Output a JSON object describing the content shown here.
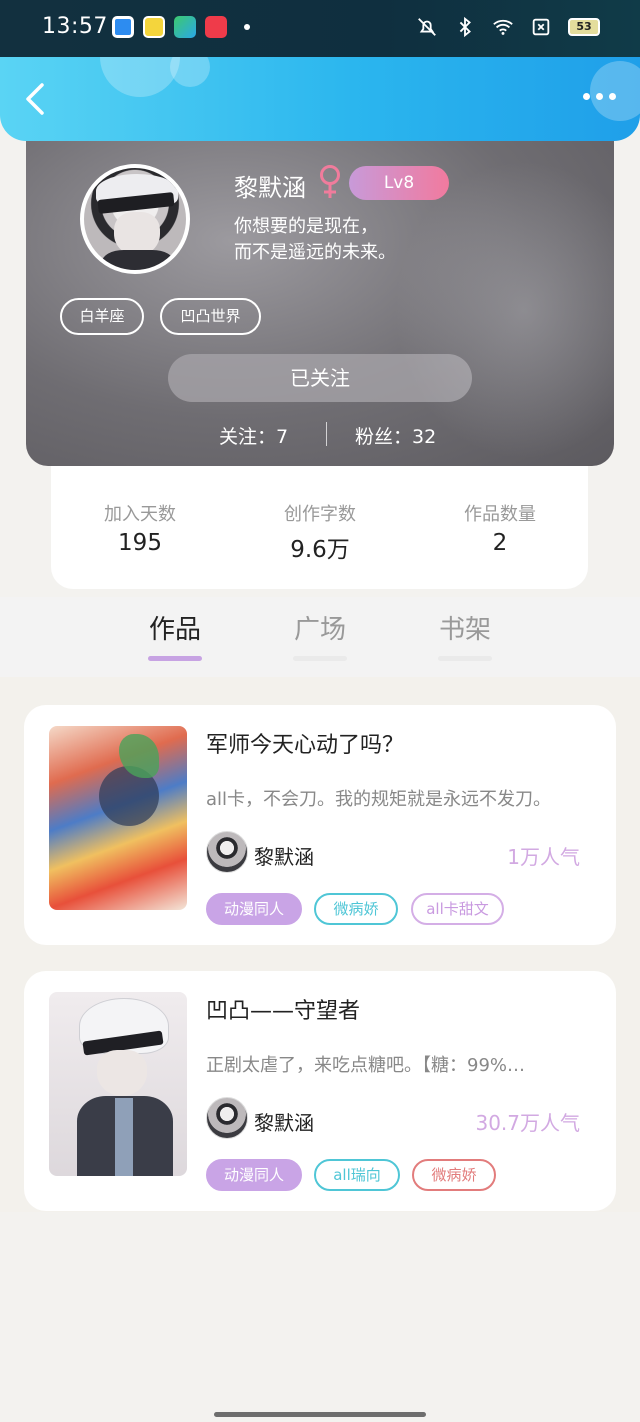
{
  "status_bar": {
    "time": "13:57",
    "battery": "53",
    "icons": [
      "app-blue-icon",
      "app-yellow-icon",
      "app-green-icon",
      "app-red-icon",
      "mute-bell-icon",
      "bluetooth-icon",
      "wifi-icon",
      "sim-x-icon",
      "battery-icon"
    ]
  },
  "header": {
    "back_icon": "chevron-left-icon",
    "more_icon": "ellipsis-icon"
  },
  "profile": {
    "name": "黎默涵",
    "gender_icon": "female-icon",
    "level": "Lv8",
    "bio_line1": "你想要的是现在，",
    "bio_line2": "而不是遥远的未来。",
    "tags": [
      "白羊座",
      "凹凸世界"
    ],
    "follow_button": "已关注",
    "following": "关注：7",
    "fans": "粉丝：32"
  },
  "stats": [
    {
      "label": "加入天数",
      "value": "195"
    },
    {
      "label": "创作字数",
      "value": "9.6万"
    },
    {
      "label": "作品数量",
      "value": "2"
    }
  ],
  "tabs": [
    {
      "label": "作品",
      "active": true
    },
    {
      "label": "广场",
      "active": false
    },
    {
      "label": "书架",
      "active": false
    }
  ],
  "works": [
    {
      "title": "军师今天心动了吗？",
      "description": "all卡，不会刀。我的规矩就是永远不发刀。",
      "author": "黎默涵",
      "popularity": "1万人气",
      "tags": [
        {
          "label": "动漫同人",
          "style": "filled-purple"
        },
        {
          "label": "微病娇",
          "style": "outline-cyan"
        },
        {
          "label": "all卡甜文",
          "style": "outline-purple"
        }
      ]
    },
    {
      "title": "凹凸——守望者",
      "description": "正剧太虐了，来吃点糖吧。【糖：99%…",
      "author": "黎默涵",
      "popularity": "30.7万人气",
      "tags": [
        {
          "label": "动漫同人",
          "style": "filled-purple"
        },
        {
          "label": "all瑞向",
          "style": "outline-cyan"
        },
        {
          "label": "微病娇",
          "style": "outline-red"
        }
      ]
    }
  ],
  "colors": {
    "header_gradient_start": "#5ad4f4",
    "header_gradient_end": "#1f9fe9",
    "accent_purple": "#c7a3e3",
    "level_badge_start": "#c89ad9",
    "level_badge_end": "#f17a9e",
    "tag_cyan": "#4fc6d6",
    "tag_red": "#e27c7c"
  }
}
